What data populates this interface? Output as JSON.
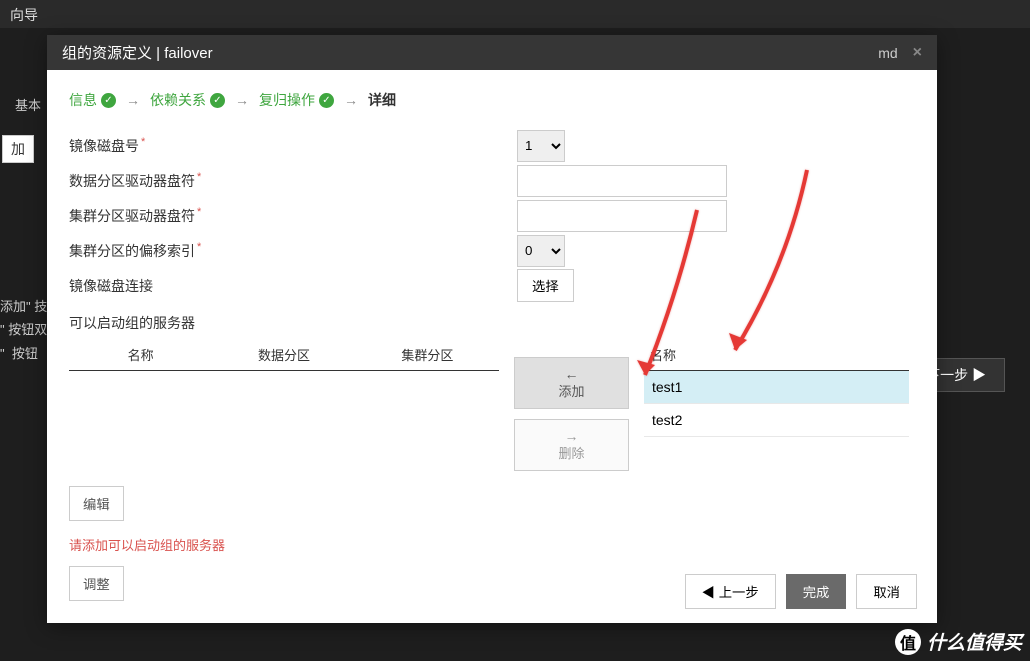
{
  "background": {
    "top_nav": "向导",
    "label1": "基本",
    "btn1": "加",
    "hint_lines": "添加\" 技\n\" 按钮双\n\"  按钮",
    "next_btn": "下一步 ▶"
  },
  "modal": {
    "title": "组的资源定义 | failover",
    "header_right": "md",
    "close_icon": "×"
  },
  "steps": {
    "s1": "信息",
    "s2": "依赖关系",
    "s3": "复归操作",
    "s4": "详细",
    "arrow": "→"
  },
  "form": {
    "mirror_disk_no": {
      "label": "镜像磁盘号",
      "value": "1"
    },
    "data_partition": {
      "label": "数据分区驱动器盘符",
      "value": ""
    },
    "cluster_partition": {
      "label": "集群分区驱动器盘符",
      "value": ""
    },
    "cluster_offset": {
      "label": "集群分区的偏移索引",
      "value": "0"
    },
    "mirror_connection": {
      "label": "镜像磁盘连接",
      "button": "选择"
    }
  },
  "servers_section_label": "可以启动组的服务器",
  "left_table": {
    "col1": "名称",
    "col2": "数据分区",
    "col3": "集群分区"
  },
  "transfer": {
    "add": "添加",
    "delete": "删除"
  },
  "right_table": {
    "col1": "名称",
    "rows": [
      "test1",
      "test2"
    ]
  },
  "lower": {
    "edit": "编辑",
    "warning": "请添加可以启动组的服务器",
    "adjust": "调整"
  },
  "footer": {
    "prev": "上一步",
    "finish": "完成",
    "cancel": "取消"
  },
  "watermark": "什么值得买"
}
